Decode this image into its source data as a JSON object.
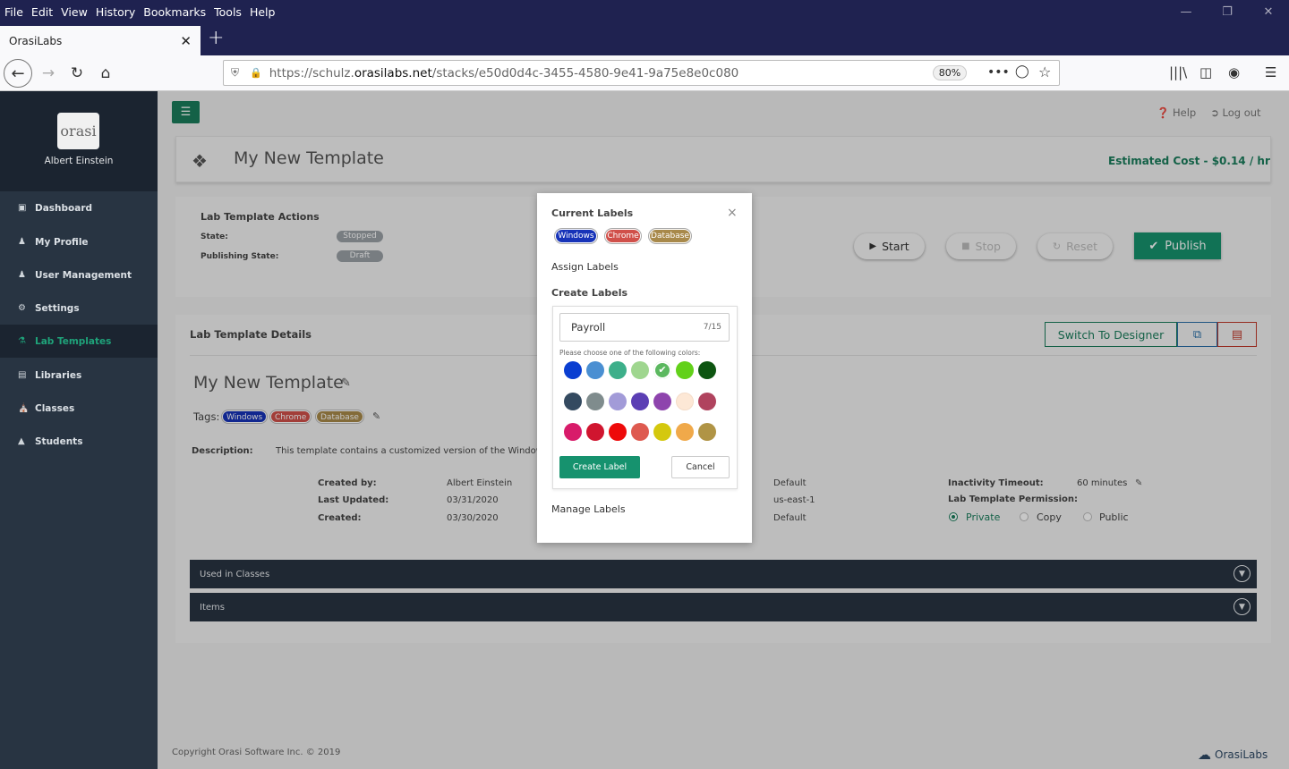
{
  "browser": {
    "menu": [
      "File",
      "Edit",
      "View",
      "History",
      "Bookmarks",
      "Tools",
      "Help"
    ],
    "tab_title": "OrasiLabs",
    "url_prefix": "https://schulz.",
    "url_domain": "orasilabs.net",
    "url_path": "/stacks/e50d0d4c-3455-4580-9e41-9a75e8e0c080",
    "zoom": "80%"
  },
  "sidebar": {
    "user": "Albert Einstein",
    "logo_text": "orasi",
    "items": [
      {
        "label": "Dashboard",
        "icon": "monitor-icon"
      },
      {
        "label": "My Profile",
        "icon": "user-icon"
      },
      {
        "label": "User Management",
        "icon": "users-icon"
      },
      {
        "label": "Settings",
        "icon": "gear-icon"
      },
      {
        "label": "Lab Templates",
        "icon": "flask-icon",
        "active": true
      },
      {
        "label": "Libraries",
        "icon": "book-icon"
      },
      {
        "label": "Classes",
        "icon": "building-icon"
      },
      {
        "label": "Students",
        "icon": "graduation-cap-icon"
      }
    ]
  },
  "header": {
    "help": "Help",
    "logout": "Log out"
  },
  "template": {
    "title": "My New Template",
    "estimated_cost": "Estimated Cost - $0.14 / hr"
  },
  "actions": {
    "heading": "Lab Template Actions",
    "state_label": "State:",
    "state_value": "Stopped",
    "publishing_label": "Publishing State:",
    "publishing_value": "Draft",
    "start": "Start",
    "stop": "Stop",
    "reset": "Reset",
    "publish": "Publish"
  },
  "details": {
    "heading": "Lab Template Details",
    "switch_designer": "Switch To Designer",
    "name": "My New Template",
    "tags_label": "Tags:",
    "tags": [
      {
        "label": "Windows",
        "color": "#1733b8"
      },
      {
        "label": "Chrome",
        "color": "#d0504a"
      },
      {
        "label": "Database",
        "color": "#a8894a"
      }
    ],
    "description_label": "Description:",
    "description": "This template contains a customized version of the Windows",
    "created_by_label": "Created by:",
    "created_by": "Albert Einstein",
    "last_updated_label": "Last Updated:",
    "last_updated": "03/31/2020",
    "created_label": "Created:",
    "created": "03/30/2020",
    "col3": [
      "Default",
      "us-east-1",
      "Default"
    ],
    "inactivity_label": "Inactivity Timeout:",
    "inactivity": "60 minutes",
    "permission_label": "Lab Template Permission:",
    "permissions": [
      "Private",
      "Copy",
      "Public"
    ],
    "permission_selected": "Private"
  },
  "accordions": [
    "Used in Classes",
    "Items"
  ],
  "footer": {
    "copyright": "Copyright Orasi Software Inc. © 2019",
    "brand": "OrasiLabs"
  },
  "modal": {
    "current_labels": "Current Labels",
    "labels": [
      {
        "label": "Windows",
        "color": "#1733b8"
      },
      {
        "label": "Chrome",
        "color": "#d0504a"
      },
      {
        "label": "Database",
        "color": "#a8894a"
      }
    ],
    "assign_labels": "Assign Labels",
    "create_labels": "Create Labels",
    "input_value": "Payroll",
    "input_count": "7/15",
    "color_prompt": "Please choose one of the following colors:",
    "colors": [
      [
        "#0a3ed1",
        "#4a8fd2",
        "#3daf8a",
        "#9fd68f",
        "#5bb85f",
        "#62d11a",
        "#0d5511"
      ],
      [
        "#344a60",
        "#7f8c8d",
        "#a29bd8",
        "#5b3fb4",
        "#8e44ad",
        "#fde8d6",
        "#b0435e"
      ],
      [
        "#d81b6a",
        "#d0152f",
        "#ee0a0a",
        "#de5a50",
        "#d4c80e",
        "#f0a94a",
        "#b09445"
      ]
    ],
    "selected_color": "#5bb85f",
    "create_btn": "Create Label",
    "cancel_btn": "Cancel",
    "manage_labels": "Manage Labels"
  }
}
